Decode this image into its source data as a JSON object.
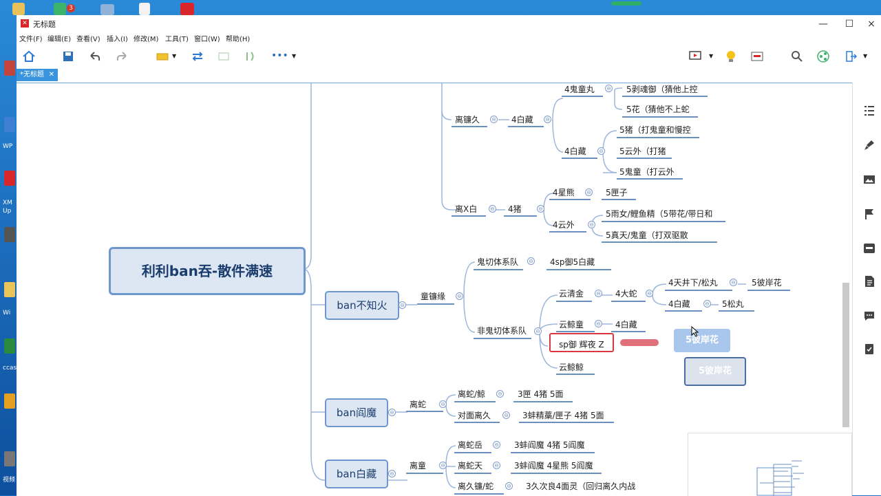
{
  "window": {
    "title": "无标题",
    "close": "×",
    "maximize": "☐",
    "minimize": "—"
  },
  "menu": [
    "文件(F)",
    "编辑(E)",
    "查看(V)",
    "插入(I)",
    "修改(M)",
    "工具(T)",
    "窗口(W)",
    "帮助(H)"
  ],
  "tab": {
    "label": "*无标题",
    "close": "✕"
  },
  "taskbar": {
    "badge": "3"
  },
  "desktop_labels": [
    "WP",
    "XM",
    "Up",
    "ccas",
    "Wi",
    "视频"
  ],
  "mindmap": {
    "root": "利利ban吞-散件满速",
    "branches": [
      {
        "label": "ban不知火"
      },
      {
        "label": "ban阎魔"
      },
      {
        "label": "ban白藏"
      }
    ],
    "nodes": {
      "likianjiu": "离镰久",
      "baizang4a": "4白藏",
      "guitongwan": "4鬼童丸",
      "sihun": "5剥魂御（猜他上控",
      "hua": "5花（猜他不上蛇",
      "baizang4b": "4白藏",
      "zhu5": "5猪（打鬼童和慢控",
      "yunwai5": "5云外（打猪",
      "guitong5": "5鬼童（打云外",
      "lixbai": "离X白",
      "zhu4": "4猪",
      "xingxiong": "4星熊",
      "xiazi": "5匣子",
      "yunwai4": "4云外",
      "yunv": "5雨女/鲤鱼精（5带花/带日和",
      "zhentian": "5真天/鬼童（打双驱散",
      "tonglianyuan": "童镰缘",
      "guiqie": "鬼切体系队",
      "sp5": "4sp御5白藏",
      "yunqingjin": "云清金",
      "dashe": "4大蛇",
      "tianjing": "4天井下/松丸",
      "bianhua": "5彼岸花",
      "baizang4c": "4白藏",
      "songwan": "5松丸",
      "feigui": "非鬼切体系队",
      "yunjingtong": "云鲸童",
      "baizang4d": "4白藏",
      "spyu": "sp御 辉夜 Z",
      "yunjingjing": "云鲸鲸",
      "lishe": "离蛇",
      "lishejing": "离蛇/鲸",
      "xia3": "3匣 4猪 5面",
      "duimian": "对面离久",
      "bang3": "3蚌精藁/匣子 4猪 5面",
      "litong": "离童",
      "lisheyue": "离蛇岳",
      "bang3b": "3蚌阎魔 4猪 5阎魔",
      "lishetian": "离蛇天",
      "bang3c": "3蚌阎魔 4星熊 5阎魔",
      "lijiu": "离久镰/蛇",
      "jiuci": "3久次良4面灵（回归离久内战"
    },
    "ghost1": "5彼岸花",
    "ghost2": "5彼岸花",
    "collapse": "⊖"
  },
  "colors": {
    "accent": "#3a93dd",
    "branch_fill": "#dde7f3",
    "branch_border": "#6f97cf",
    "selected": "#d9363e"
  }
}
